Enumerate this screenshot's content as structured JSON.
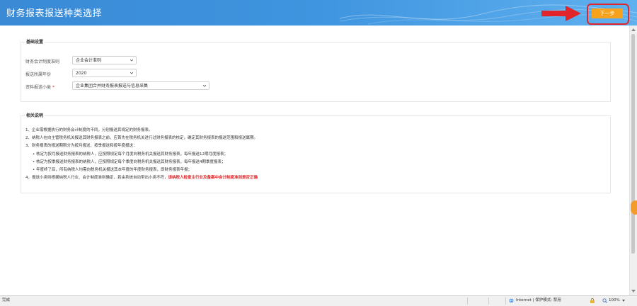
{
  "header": {
    "title": "财务报表报送种类选择",
    "next_label": "下一步"
  },
  "basic": {
    "title": "基础设置",
    "rows": [
      {
        "label": "财务会计制度准则",
        "required": false,
        "value": "企业会计准则"
      },
      {
        "label": "报送所属年份",
        "required": false,
        "value": "2020"
      },
      {
        "label": "资料报送小类",
        "required": true,
        "value": "企业集团合并财务报表报送与信息采集"
      }
    ]
  },
  "notes": {
    "title": "相关说明",
    "items": [
      {
        "text": "1、企业需根据执行的财务会计制度的不同，分别报送其规定的财务报表。",
        "sub": false
      },
      {
        "text": "2、纳税人在向主管税务机关报送其财务报表之前，应首先在税务机关进行过财务报表的核定，确定其财务报表的报送范围和报送属期。",
        "sub": false
      },
      {
        "text": "3、财务报表的报送期限分为按月报送、按季报送和按年度报送：",
        "sub": false
      },
      {
        "text": "• 核定为按月报送财务报表的纳税人，应按照规定每个月度向税务机关报送其财务报表，每年报送12期月度报表；",
        "sub": true
      },
      {
        "text": "• 核定为按季报送财务报表的纳税人，应按照规定每个季度向税务机关报送其财务报表，每年报送4期季度报表；",
        "sub": true
      },
      {
        "text": "• 年度终了后，所有纳税人均需向税务机关报送其本年度的年度财务报表，即财务报表年报；",
        "sub": true
      },
      {
        "text": "4、报送小类则根据纳税人行业、会计制度准则确定，若由系统自动带出小类不符，",
        "sub": false,
        "warn": "请纳税人检查主行业及备案中会计制度准则是否正确"
      }
    ]
  },
  "statusbar": {
    "left": "完成",
    "zone": "Internet | 保护模式: 禁用",
    "zoom": "100%"
  },
  "colors": {
    "header_start": "#3a8ad6",
    "next_button": "#f7a21c",
    "highlight_red": "#e0262a"
  }
}
